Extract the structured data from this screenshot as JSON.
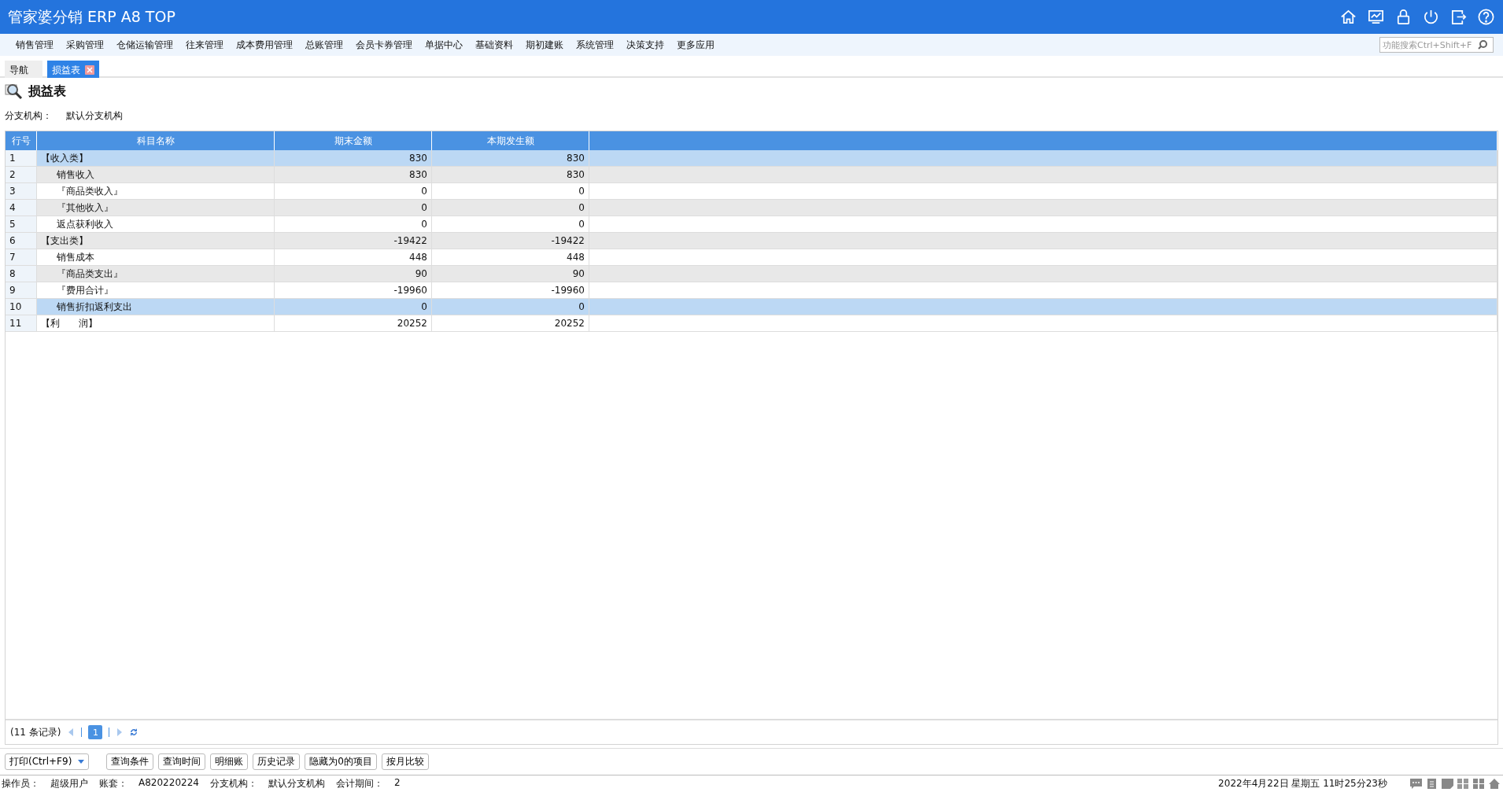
{
  "app_title": "管家婆分销 ERP A8 TOP",
  "menu": [
    "销售管理",
    "采购管理",
    "仓储运输管理",
    "往来管理",
    "成本费用管理",
    "总账管理",
    "会员卡券管理",
    "单据中心",
    "基础资料",
    "期初建账",
    "系统管理",
    "决策支持",
    "更多应用"
  ],
  "search": {
    "placeholder": "功能搜索Ctrl+Shift+F"
  },
  "tabs": [
    {
      "label": "导航",
      "selected": false,
      "closable": false
    },
    {
      "label": "损益表",
      "selected": true,
      "closable": true
    }
  ],
  "page_title": "损益表",
  "filter": {
    "label": "分支机构：",
    "value": "默认分支机构"
  },
  "table": {
    "columns": [
      "行号",
      "科目名称",
      "期末金额",
      "本期发生额"
    ],
    "rows": [
      {
        "no": "1",
        "name": "【收入类】",
        "end": "830",
        "period": "830",
        "selected": true,
        "children": [
          {
            "no": "2",
            "name": "销售收入",
            "end": "830",
            "period": "830",
            "selected": false
          },
          {
            "no": "3",
            "name": "『商品类收入』",
            "end": "0",
            "period": "0",
            "selected": false
          },
          {
            "no": "4",
            "name": "『其他收入』",
            "end": "0",
            "period": "0",
            "selected": false
          },
          {
            "no": "5",
            "name": "返点获利收入",
            "end": "0",
            "period": "0",
            "selected": false
          }
        ]
      },
      {
        "no": "6",
        "name": "【支出类】",
        "end": "-19422",
        "period": "-19422",
        "selected": false,
        "children": [
          {
            "no": "7",
            "name": "销售成本",
            "end": "448",
            "period": "448",
            "selected": false
          },
          {
            "no": "8",
            "name": "『商品类支出』",
            "end": "90",
            "period": "90",
            "selected": false
          },
          {
            "no": "9",
            "name": "『费用合计』",
            "end": "-19960",
            "period": "-19960",
            "selected": false
          },
          {
            "no": "10",
            "name": "销售折扣返利支出",
            "end": "0",
            "period": "0",
            "selected": true
          }
        ]
      },
      {
        "no": "11",
        "name": "【利　　润】",
        "end": "20252",
        "period": "20252",
        "selected": false
      }
    ]
  },
  "pager": {
    "count": "(11 条记录)",
    "pages": [
      {
        "label": "1",
        "selected": true
      }
    ]
  },
  "buttons": [
    {
      "label": "打印(Ctrl+F9)",
      "kind": "dropdown"
    },
    {
      "label": "查询条件",
      "kind": "plain"
    },
    {
      "label": "查询时间",
      "kind": "plain"
    },
    {
      "label": "明细账",
      "kind": "plain"
    },
    {
      "label": "历史记录",
      "kind": "plain"
    },
    {
      "label": "隐藏为0的项目",
      "kind": "plain"
    },
    {
      "label": "按月比较",
      "kind": "plain"
    }
  ],
  "status_bar": {
    "fields": [
      {
        "label": "操作员：",
        "value": "超级用户"
      },
      {
        "label": "账套：",
        "value": "A820220224"
      },
      {
        "label": "分支机构：",
        "value": "默认分支机构"
      },
      {
        "label": "会计期间：",
        "value": "2"
      }
    ],
    "datetime": "2022年4月22日  星期五  11时25分23秒"
  }
}
